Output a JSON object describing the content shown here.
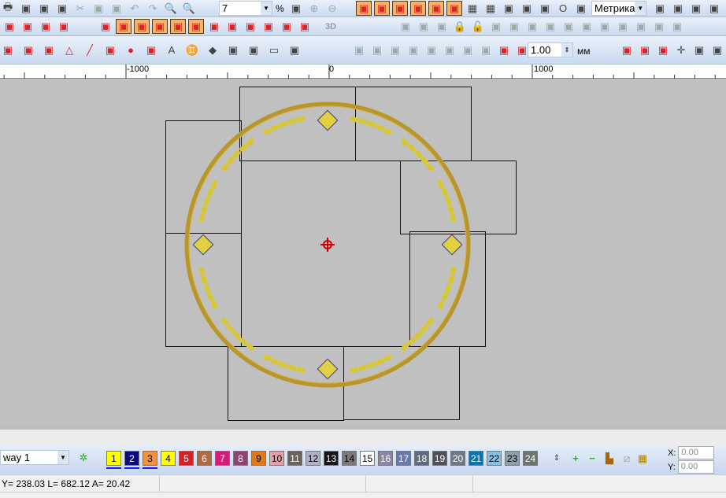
{
  "toolbar1": {
    "icons_left": [
      "print-icon",
      "print-preview-icon",
      "sew-icon",
      "embroidery-machine-icon",
      "cut-icon",
      "copy-icon",
      "paste-icon",
      "undo-icon",
      "redo-icon",
      "zoom-icon",
      "zoom-1to1-icon"
    ],
    "zoom_value": "7",
    "percent_label": "%",
    "icons_mid": [
      "zoom-fit-icon",
      "zoom-in-icon",
      "zoom-out-icon"
    ],
    "icons_tools": [
      "satin-column-icon",
      "fill-stitch-icon",
      "leaf-icon",
      "lasso-icon",
      "run-stitch-icon",
      "candlewick-icon",
      "grid-icon",
      "hoop-grid-icon",
      "picture-icon",
      "shapes-icon",
      "color-balls-icon",
      "hoop-icon",
      "auto-digitize-icon"
    ],
    "units_value": "Метрика",
    "icons_right": [
      "thread-chart-icon",
      "dotted-grid-icon",
      "color-list-icon",
      "stitch-list-icon"
    ]
  },
  "toolbar2": {
    "icons_a": [
      "grid-fill-icon",
      "wave-fill-icon",
      "cross-fill-icon",
      "maze-fill-icon"
    ],
    "icons_b": [
      "stitch-type-1-icon",
      "stitch-type-2-icon",
      "stitch-type-3-icon",
      "stitch-type-4-icon",
      "stitch-type-5-icon",
      "stitch-type-6-icon",
      "stitch-type-7-icon",
      "stitch-type-8-icon",
      "stitch-type-9-icon",
      "stitch-type-10-icon",
      "stitch-type-11-icon",
      "stitch-type-12-icon"
    ],
    "label_3d": "3D",
    "icons_c": [
      "group-icon",
      "ungroup-icon",
      "combine-icon",
      "lock-icon",
      "unlock-icon",
      "align-left-icon",
      "align-center-icon",
      "align-right-icon",
      "align-top-icon",
      "align-middle-icon",
      "align-bottom-icon",
      "distribute-h-icon",
      "distribute-v-icon",
      "space-h-icon",
      "space-v-icon",
      "center-icon"
    ]
  },
  "toolbar3": {
    "icons_a": [
      "freehand-icon",
      "wave-line-icon",
      "node-edit-icon",
      "polygon-icon",
      "line-icon",
      "polyline-icon",
      "circle-icon",
      "arc-icon",
      "text-icon",
      "people-icon",
      "monogram-icon",
      "outline-icon",
      "transform-icon",
      "rectangle-icon",
      "split-icon"
    ],
    "icons_b": [
      "weld-icon",
      "trim-icon",
      "intersect-icon",
      "subtract-icon",
      "front-minus-icon",
      "back-minus-icon",
      "overlap-icon",
      "exclude-icon",
      "offset-icon",
      "offset-round-icon"
    ],
    "offset_value": "1.00",
    "unit_label": "мм",
    "icons_c": [
      "hoop-red-icon",
      "hoop-oval-icon",
      "hoop-fill-icon",
      "center-cross-icon",
      "frame-icon",
      "machine-icon"
    ]
  },
  "ruler": {
    "labels": [
      "-1000",
      "0",
      "1000"
    ]
  },
  "palette": {
    "layer_value": "way 1",
    "colors": [
      [
        "1",
        "#ffff00",
        "#000"
      ],
      [
        "2",
        "#0a0a80",
        "#fff"
      ],
      [
        "3",
        "#f5913a",
        "#000"
      ],
      [
        "4",
        "#ffff00",
        "#000"
      ],
      [
        "5",
        "#d92020",
        "#fff"
      ],
      [
        "6",
        "#b06a40",
        "#fff"
      ],
      [
        "7",
        "#d81b78",
        "#fff"
      ],
      [
        "8",
        "#8d4470",
        "#fff"
      ],
      [
        "9",
        "#e07a18",
        "#000"
      ],
      [
        "10",
        "#e8a0a8",
        "#000"
      ],
      [
        "11",
        "#6b625a",
        "#fff"
      ],
      [
        "12",
        "#b4b0cc",
        "#000"
      ],
      [
        "13",
        "#151515",
        "#fff"
      ],
      [
        "14",
        "#7a7a7a",
        "#000"
      ],
      [
        "15",
        "#ffffff",
        "#000"
      ],
      [
        "16",
        "#8a86aa",
        "#fff"
      ],
      [
        "17",
        "#6a7aa8",
        "#fff"
      ],
      [
        "18",
        "#606a80",
        "#fff"
      ],
      [
        "19",
        "#505058",
        "#fff"
      ],
      [
        "20",
        "#6e7a8a",
        "#fff"
      ],
      [
        "21",
        "#0a74b0",
        "#fff"
      ],
      [
        "22",
        "#86c0e4",
        "#000"
      ],
      [
        "23",
        "#90a0a8",
        "#000"
      ],
      [
        "24",
        "#6c7470",
        "#fff"
      ]
    ],
    "x_label": "X:",
    "x_value": "0.00",
    "y_label": "Y:",
    "y_value": "0.00"
  },
  "status": {
    "coords": "Y= 238.03 L= 682.12 A=  20.42"
  }
}
